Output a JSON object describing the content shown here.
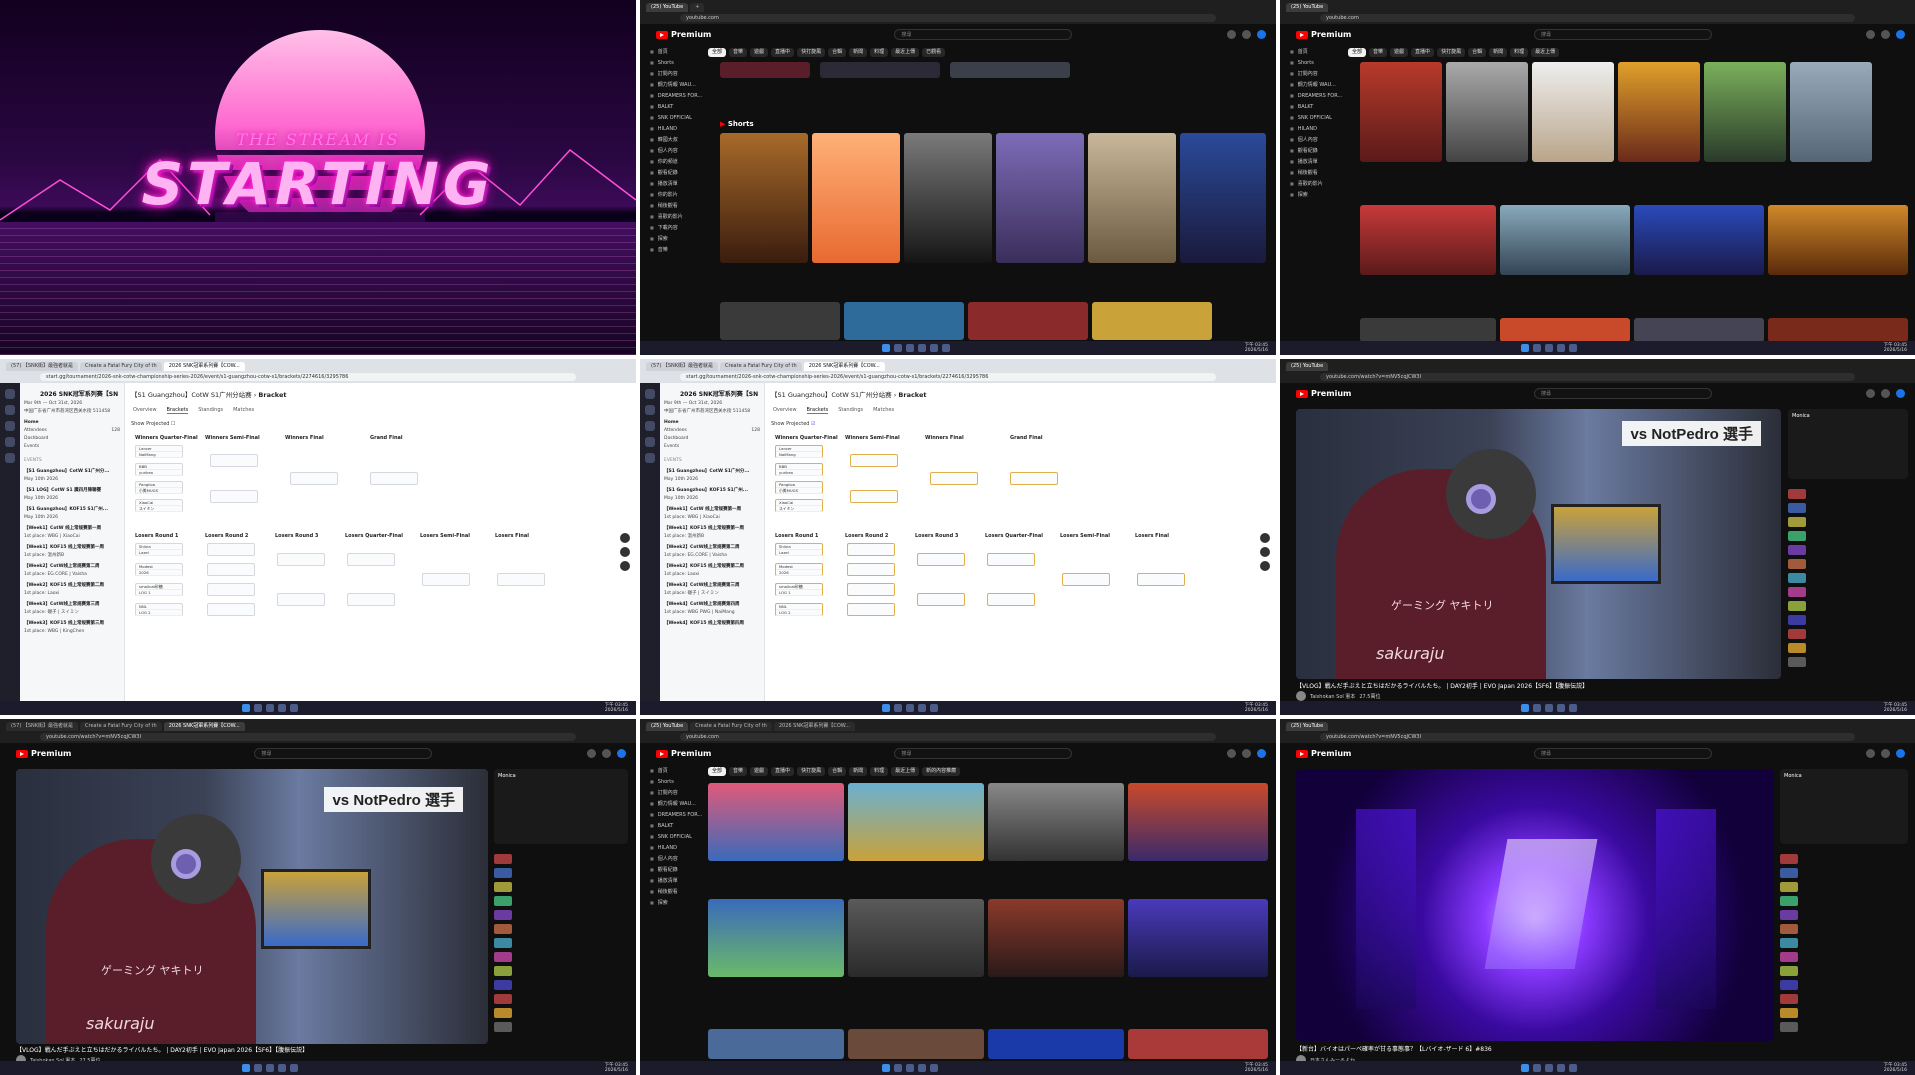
{
  "starting": {
    "subtitle": "THE STREAM IS",
    "title": "STARTING"
  },
  "yt": {
    "logo": "Premium",
    "search_placeholder": "搜尋",
    "home_url": "youtube.com",
    "tab_title": "(25) YouTube",
    "chips": [
      "全部",
      "音樂",
      "遊戲",
      "直播中",
      "快打旋風",
      "合輯",
      "新聞",
      "料理",
      "最近上傳",
      "已觀看",
      "新的內容推薦"
    ],
    "sidebar": [
      "首頁",
      "Shorts",
      "訂閱內容",
      "鋼力情報 WAU...",
      "DREAMERS FOR...",
      "BALKT",
      "SNK OFFICIAL",
      "HILAND",
      "韓國大叔",
      "繼續觀看",
      "個人內容",
      "你的頻道",
      "觀看紀錄",
      "播放清單",
      "你的影片",
      "稍後觀看",
      "喜歡的影片",
      "下載內容",
      "探索",
      "音樂",
      "遊戲"
    ],
    "shorts_label": "Shorts"
  },
  "bracket": {
    "url": "start.gg/tournament/2026-snk-cotw-championship-series-2026/event/s1-guangzhou-cotw-s1/brackets/2274616/3295786",
    "tabs_browser": [
      "(57) 【SNK街】最強者就是",
      "Create a Fatal Fury City of th",
      "2026 SNK冠軍系列賽【COW..."
    ],
    "title": "2026 SNK冠军系列赛【SN",
    "date": "Mar 9th — Oct 31st, 2026",
    "location": "中国广东省广州市荔湾区西关水街 511458",
    "nav": [
      "Home",
      "Attendees",
      "Dashboard",
      "Events"
    ],
    "attendees_count": "128",
    "events_label": "EVENTS",
    "events": [
      {
        "name": "【S1 Guangzhou】CotW S1广州分...",
        "sub": "May 10th 2026"
      },
      {
        "name": "【S1 LOG】CotW S1 廣四月陳聯賽",
        "sub": "May 10th 2026"
      },
      {
        "name": "【S1 Guangzhou】KOF15 S1广州...",
        "sub": "May 10th 2026"
      },
      {
        "name": "【Week1】CotW 线上常规赛第一周",
        "sub": "1st place: WBG | XiaoCai"
      },
      {
        "name": "【Week1】KOF15 线上常规赛第一周",
        "sub": "1st place: 温州新B"
      },
      {
        "name": "【Week2】CotW线上常规赛第二周",
        "sub": "1st place: EG.CORE | Vaisha"
      },
      {
        "name": "【Week2】KOF15 线上常规赛第二周",
        "sub": "1st place: Laoxi"
      },
      {
        "name": "【Week3】CotW线上常规赛第三周",
        "sub": "1st place: 碾子 | スイミン"
      },
      {
        "name": "【Week3】KOF15 线上常规赛第三周",
        "sub": "1st place: WBG | KingChen"
      },
      {
        "name": "【Week4】CotW线上常规赛第四周",
        "sub": "1st place: WBG PWG | NaiMang"
      },
      {
        "name": "【Week4】KOF15 线上常规赛第四周",
        "sub": ""
      }
    ],
    "event_title": "【S1 Guangzhou】CotW S1广州分站赛",
    "bracket_label": "Bracket",
    "page_tabs": [
      "Overview",
      "Brackets",
      "Standings",
      "Matches"
    ],
    "show_projected": "Show Projected",
    "winners_rounds": [
      "Winners Quarter-Final",
      "Winners Semi-Final",
      "Winners Final",
      "Grand Final"
    ],
    "losers_rounds": [
      "Losers Round 1",
      "Losers Round 2",
      "Losers Round 3",
      "Losers Quarter-Final",
      "Losers Semi-Final",
      "Losers Final"
    ],
    "wqf": [
      [
        "Lancer",
        "NaiMang"
      ],
      [
        "BBB",
        "yurikeo"
      ],
      [
        "Pangiloo",
        "小美MUGS"
      ],
      [
        "XiaoCai",
        "スイミン"
      ]
    ],
    "lr1": [
      [
        "Shiina",
        "Lazel"
      ],
      [
        "Modest",
        "2026"
      ],
      [
        "smallcat砂糖",
        "LOG 1"
      ],
      [
        "NNL",
        "LOG 2"
      ]
    ]
  },
  "watch": {
    "url": "youtube.com/watch?v=mNV5cqJCW3I",
    "vs_text": "vs NotPedro 選手",
    "shirt_text": "ゲーミング ヤキトリ",
    "brand": "sakuraju",
    "title": "【VLOG】戦んだ手ぶえと立ちはだかるライバルたち。 | DAY2初手 | EVO Japan 2026【SF6】【腹振伝説】",
    "channel": "Taishokan Sol 憲本",
    "subs": "27.5萬位",
    "chat_user": "Monica",
    "title2": "【新台】バイオはパーペ確率が甘る事態事？【Lバイオ-ザード 6】#836",
    "channel2": "日本さんみーるよか"
  },
  "taskbar": {
    "time": "下午 03:45",
    "date": "2026/5/16",
    "search": "搜尋"
  },
  "colors": {
    "yt_red": "#ff0000",
    "start_pink": "#ff3ad0",
    "bracket_accent": "#e2b04a"
  }
}
